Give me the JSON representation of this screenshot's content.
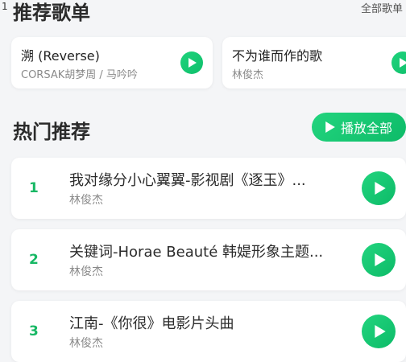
{
  "status_bar": {
    "left_fragment": "1"
  },
  "recommend_section": {
    "title": "推荐歌单",
    "more_label": "全部歌单",
    "cards": [
      {
        "title": "溯 (Reverse)",
        "artist": "CORSAK胡梦周 / 马吟吟"
      },
      {
        "title": "不为谁而作的歌",
        "artist": "林俊杰"
      }
    ]
  },
  "hot_section": {
    "title": "热门推荐",
    "play_all_label": "播放全部",
    "songs": [
      {
        "rank": "1",
        "title": "我对缘分小心翼翼-影视剧《逐玉》...",
        "artist": "林俊杰"
      },
      {
        "rank": "2",
        "title": "关键词-Horae Beauté 韩媞形象主题...",
        "artist": "林俊杰"
      },
      {
        "rank": "3",
        "title": "江南-《你很》电影片头曲",
        "artist": "林俊杰"
      }
    ]
  },
  "colors": {
    "accent": "#1fd37c",
    "background": "#f4f5f7"
  },
  "icons": {
    "play": "play-icon"
  }
}
